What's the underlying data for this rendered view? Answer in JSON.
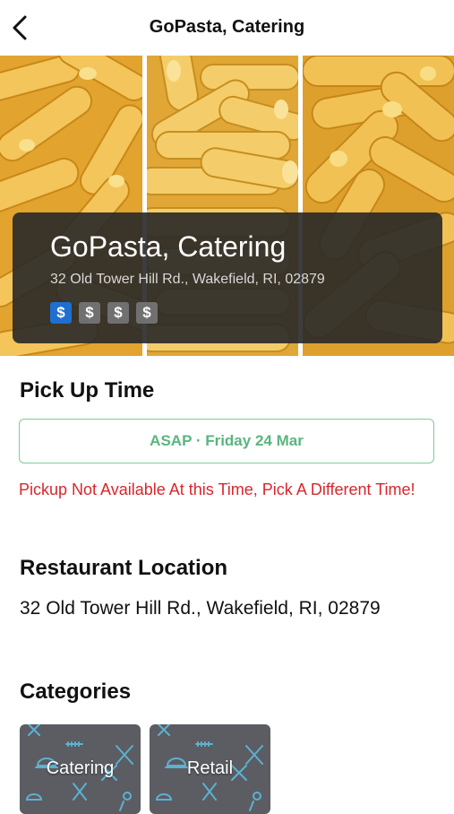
{
  "header": {
    "title": "GoPasta, Catering",
    "back_icon": "chevron-left-icon"
  },
  "hero": {
    "title": "GoPasta, Catering",
    "address": "32 Old Tower Hill Rd., Wakefield, RI, 02879",
    "price_symbol": "$",
    "price_level": 1,
    "price_max": 4,
    "colors": {
      "active_price": "#1e6fd0",
      "inactive_price": "#707070",
      "card_bg": "#282828"
    }
  },
  "pickup": {
    "heading": "Pick Up Time",
    "selected_value": "ASAP · Friday 24 Mar",
    "error_message": "Pickup Not Available At this Time, Pick A Different Time!",
    "colors": {
      "border": "#7fcc99",
      "text": "#59b67e",
      "error": "#d9262c"
    }
  },
  "location": {
    "heading": "Restaurant Location",
    "address": "32 Old Tower Hill Rd., Wakefield, RI, 02879"
  },
  "categories": {
    "heading": "Categories",
    "items": [
      {
        "label": "Catering"
      },
      {
        "label": "Retail"
      }
    ]
  }
}
